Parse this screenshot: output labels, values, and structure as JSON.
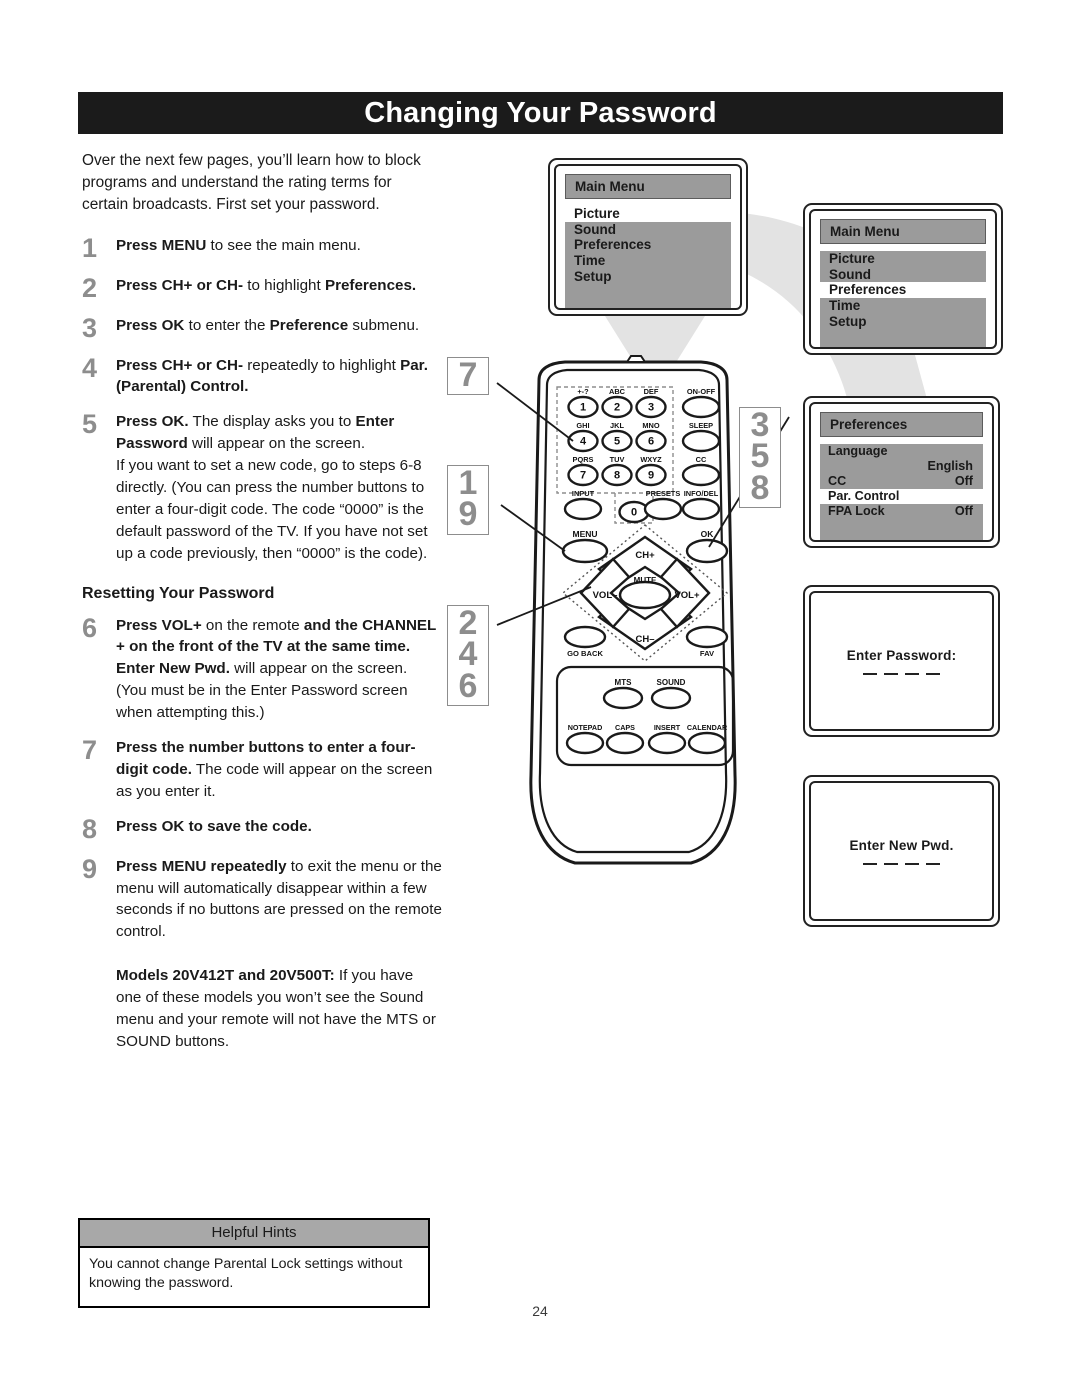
{
  "page": {
    "title": "Changing Your Password",
    "number": "24"
  },
  "intro": "Over the next few pages, you’ll learn how to block programs and understand the rating terms for certain broadcasts. First set your password.",
  "steps": [
    {
      "num": "1",
      "html": "<b>Press MENU</b> to see the main menu."
    },
    {
      "num": "2",
      "html": "<b>Press CH+ or CH-</b> to highlight <b>Preferences.</b>"
    },
    {
      "num": "3",
      "html": "<b>Press OK</b> to enter the <b>Preference</b> submenu."
    },
    {
      "num": "4",
      "html": "<b>Press CH+ or CH-</b> repeatedly to highlight <b>Par. (Parental) Control.</b>"
    },
    {
      "num": "5",
      "html": "<b>Press OK.</b> The display asks you to <b>Enter Password</b> will appear on the screen.<br>If you want to set a new code, go to steps 6-8 directly. (You can press the number buttons to enter a four-digit code. The code “0000” is the default password of the TV. If you have not set up a code previously, then “0000” is the code)."
    }
  ],
  "subhead": "Resetting Your Password",
  "steps2": [
    {
      "num": "6",
      "html": "<b>Press VOL+</b> on the remote <b>and the CHANNEL + on the front of the TV at the same time. Enter New Pwd.</b> will appear on the screen. (You must be in the Enter Password screen when attempting this.)"
    },
    {
      "num": "7",
      "html": "<b>Press the number buttons to enter a four-digit code.</b> The code will appear on the screen as you enter it."
    },
    {
      "num": "8",
      "html": "<b>Press OK to save the code.</b>"
    },
    {
      "num": "9",
      "html": "<b>Press MENU repeatedly</b> to exit the menu or the menu will automatically disappear within a few seconds if no buttons are pressed on the remote control."
    }
  ],
  "models_note": "<b>Models 20V412T and 20V500T:</b> If you have one of these models you won’t see the Sound menu and your remote will not have the MTS or SOUND buttons.",
  "hints": {
    "header": "Helpful Hints",
    "body": "You cannot change Parental Lock settings without knowing the password."
  },
  "screens": {
    "main_menu_1": {
      "title": "Main Menu",
      "items": [
        "Picture",
        "Sound",
        "Preferences",
        "Time",
        "Setup"
      ],
      "selected": "Picture"
    },
    "main_menu_2": {
      "title": "Main Menu",
      "items": [
        "Picture",
        "Sound",
        "Preferences",
        "Time",
        "Setup"
      ],
      "selected": "Preferences"
    },
    "preferences": {
      "title": "Preferences",
      "rows": [
        {
          "label": "Language",
          "value": "English"
        },
        {
          "label": "CC",
          "value": "Off"
        },
        {
          "label": "Par. Control",
          "value": ""
        },
        {
          "label": "FPA Lock",
          "value": "Off"
        }
      ],
      "selected": "Par. Control"
    },
    "enter_password": {
      "label": "Enter Password:",
      "dashes": 4
    },
    "enter_new_pwd": {
      "label": "Enter New Pwd.",
      "dashes": 4
    }
  },
  "remote": {
    "keypad": [
      {
        "sub": "+-?",
        "key": "1"
      },
      {
        "sub": "ABC",
        "key": "2"
      },
      {
        "sub": "DEF",
        "key": "3"
      },
      {
        "sub": "GHI",
        "key": "4"
      },
      {
        "sub": "JKL",
        "key": "5"
      },
      {
        "sub": "MNO",
        "key": "6"
      },
      {
        "sub": "PQRS",
        "key": "7"
      },
      {
        "sub": "TUV",
        "key": "8"
      },
      {
        "sub": "WXYZ",
        "key": "9"
      }
    ],
    "right_column": [
      "ON-OFF",
      "SLEEP",
      "CC",
      "INFO/DEL"
    ],
    "row_input": [
      "INPUT",
      "0",
      "PRESETS"
    ],
    "menu_label": "MENU",
    "ok_label": "OK",
    "dpad": {
      "up": "CH+",
      "down": "CH–",
      "left": "VOL–",
      "right": "VOL+",
      "center": "MUTE"
    },
    "go_back": "GO BACK",
    "fav": "FAV",
    "mts": "MTS",
    "sound": "SOUND",
    "bottom_row": [
      "NOTEPAD",
      "CAPS",
      "INSERT",
      "CALENDAR"
    ],
    "callouts": {
      "keypad": "7",
      "menu": "1\n9",
      "ok": "3\n5\n8",
      "dpad": "2\n4\n6"
    }
  }
}
